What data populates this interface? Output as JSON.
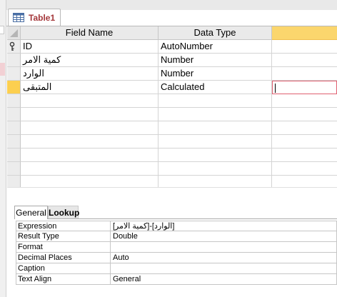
{
  "document_tab": {
    "label": "Table1",
    "icon": "table-icon"
  },
  "grid": {
    "headers": {
      "field_name": "Field Name",
      "data_type": "Data Type",
      "description": ""
    },
    "rows": [
      {
        "field_name": "ID",
        "data_type": "AutoNumber",
        "primary_key": true
      },
      {
        "field_name": "كمية الامر",
        "data_type": "Number"
      },
      {
        "field_name": "الوارد",
        "data_type": "Number"
      },
      {
        "field_name": "المتبقى",
        "data_type": "Calculated",
        "current": true
      }
    ],
    "empty_rows": 6
  },
  "properties": {
    "tabs": [
      "General",
      "Lookup"
    ],
    "active_tab": "General",
    "rows": [
      {
        "name": "Expression",
        "value": "[الوارد]-[كمية الامر]"
      },
      {
        "name": "Result Type",
        "value": "Double"
      },
      {
        "name": "Format",
        "value": ""
      },
      {
        "name": "Decimal Places",
        "value": "Auto"
      },
      {
        "name": "Caption",
        "value": ""
      },
      {
        "name": "Text Align",
        "value": "General"
      }
    ]
  },
  "colors": {
    "tab_text": "#a4373a",
    "current_row_selector": "#fccf4f",
    "active_header": "#fbd66d",
    "active_cell_border": "#e06070"
  }
}
